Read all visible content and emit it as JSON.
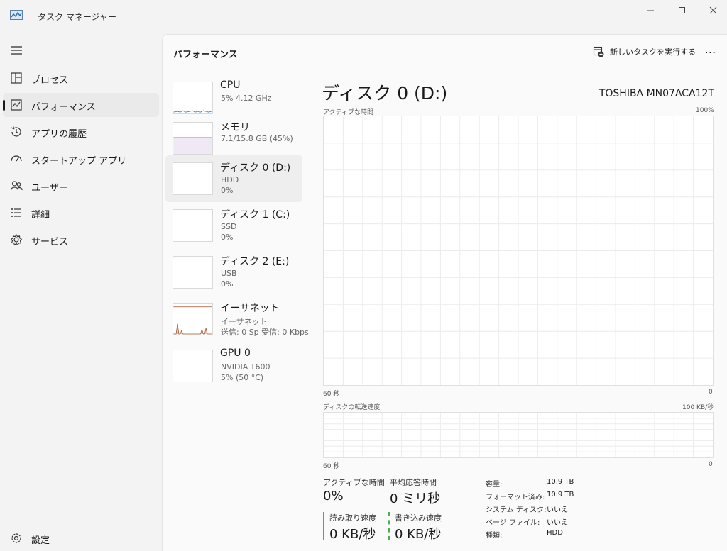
{
  "window": {
    "title": "タスク マネージャー",
    "controls": {
      "minimize": "—",
      "maximize": "☐",
      "close": "✕"
    }
  },
  "nav": {
    "items": [
      {
        "label": "プロセス",
        "icon": "processes-icon"
      },
      {
        "label": "パフォーマンス",
        "icon": "performance-icon",
        "selected": true
      },
      {
        "label": "アプリの履歴",
        "icon": "app-history-icon"
      },
      {
        "label": "スタートアップ アプリ",
        "icon": "startup-apps-icon"
      },
      {
        "label": "ユーザー",
        "icon": "users-icon"
      },
      {
        "label": "詳細",
        "icon": "details-icon"
      },
      {
        "label": "サービス",
        "icon": "services-icon"
      }
    ],
    "settings_label": "設定"
  },
  "header": {
    "title": "パフォーマンス",
    "new_task_label": "新しいタスクを実行する",
    "more_label": "⋯"
  },
  "devices": [
    {
      "name": "CPU",
      "sub1": "5% 4.12 GHz",
      "sub2": ""
    },
    {
      "name": "メモリ",
      "sub1": "7.1/15.8 GB (45%)",
      "sub2": ""
    },
    {
      "name": "ディスク 0 (D:)",
      "sub1": "HDD",
      "sub2": "0%",
      "selected": true
    },
    {
      "name": "ディスク 1 (C:)",
      "sub1": "SSD",
      "sub2": "0%"
    },
    {
      "name": "ディスク 2 (E:)",
      "sub1": "USB",
      "sub2": "0%"
    },
    {
      "name": "イーサネット",
      "sub1": "イーサネット",
      "sub2": "送信: 0 Sp 受信: 0 Kbps"
    },
    {
      "name": "GPU 0",
      "sub1": "NVIDIA T600",
      "sub2": "5% (50 °C)"
    }
  ],
  "detail": {
    "title": "ディスク 0 (D:)",
    "model": "TOSHIBA MN07ACA12T",
    "graph1": {
      "label": "アクティブな時間",
      "max_label": "100%",
      "x_left": "60 秒",
      "x_right": "0"
    },
    "graph2": {
      "label": "ディスクの転送速度",
      "max_label": "100 KB/秒",
      "x_left": "60 秒",
      "x_right": "0"
    },
    "stats": {
      "active_time_label": "アクティブな時間",
      "active_time_value": "0%",
      "avg_response_label": "平均応答時間",
      "avg_response_value": "0 ミリ秒",
      "read_speed_label": "読み取り速度",
      "read_speed_value": "0 KB/秒",
      "write_speed_label": "書き込み速度",
      "write_speed_value": "0 KB/秒"
    },
    "properties": [
      {
        "label": "容量:",
        "value": "10.9 TB"
      },
      {
        "label": "フォーマット済み:",
        "value": "10.9 TB"
      },
      {
        "label": "システム ディスク:",
        "value": "いいえ"
      },
      {
        "label": "ページ ファイル:",
        "value": "いいえ"
      },
      {
        "label": "種類:",
        "value": "HDD"
      }
    ]
  },
  "colors": {
    "cpu_graph": "#4a90c8",
    "memory_graph": "#8e44ad",
    "ethernet_graph": "#a0522d",
    "disk_bar": "#4caf50"
  }
}
